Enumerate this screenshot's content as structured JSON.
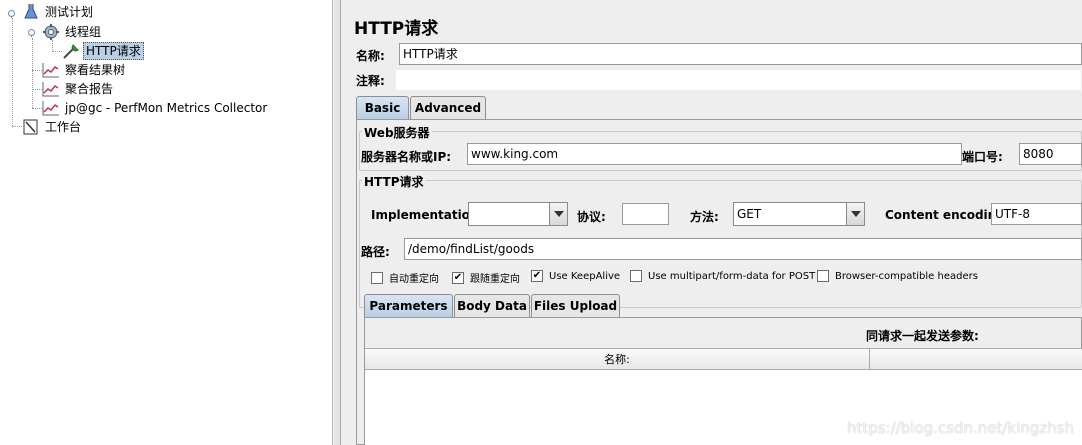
{
  "tree": {
    "items": [
      {
        "label": "测试计划",
        "icon": "test-plan-icon"
      },
      {
        "label": "线程组",
        "icon": "thread-group-gear-icon"
      },
      {
        "label": "HTTP请求",
        "icon": "http-sampler-dropper-icon",
        "selected": true
      },
      {
        "label": "察看结果树",
        "icon": "listener-chart-icon"
      },
      {
        "label": "聚合报告",
        "icon": "listener-chart-icon"
      },
      {
        "label": "jp@gc - PerfMon Metrics Collector",
        "icon": "listener-chart-icon"
      },
      {
        "label": "工作台",
        "icon": "workbench-icon"
      }
    ]
  },
  "panel": {
    "title": "HTTP请求",
    "name_label": "名称:",
    "name_value": "HTTP请求",
    "comment_label": "注释:",
    "comment_value": "",
    "tabs": [
      {
        "label": "Basic",
        "active": true
      },
      {
        "label": "Advanced",
        "active": false
      }
    ],
    "web_server": {
      "title": "Web服务器",
      "server_label": "服务器名称或IP:",
      "server_value": "www.king.com",
      "port_label": "端口号:",
      "port_value": "8080"
    },
    "http_request": {
      "title": "HTTP请求",
      "implementation_label": "Implementation:",
      "implementation_value": "",
      "protocol_label": "协议:",
      "protocol_value": "",
      "method_label": "方法:",
      "method_value": "GET",
      "encoding_label": "Content encoding:",
      "encoding_value": "UTF-8",
      "path_label": "路径:",
      "path_value": "/demo/findList/goods"
    },
    "checkboxes": [
      {
        "label": "自动重定向",
        "checked": false
      },
      {
        "label": "跟随重定向",
        "checked": true
      },
      {
        "label": "Use KeepAlive",
        "checked": true
      },
      {
        "label": "Use multipart/form-data for POST",
        "checked": false
      },
      {
        "label": "Browser-compatible headers",
        "checked": false
      }
    ],
    "sub_tabs": [
      {
        "label": "Parameters",
        "active": true
      },
      {
        "label": "Body Data",
        "active": false
      },
      {
        "label": "Files Upload",
        "active": false
      }
    ],
    "params_caption": "同请求一起发送参数:",
    "table_columns": [
      "名称:",
      ""
    ]
  },
  "watermark": "https://blog.csdn.net/kingzhsh",
  "colors": {
    "selection": "#b8cfe5",
    "active_tab": "#c3d6ea",
    "panel_bg": "#eeeeee"
  }
}
